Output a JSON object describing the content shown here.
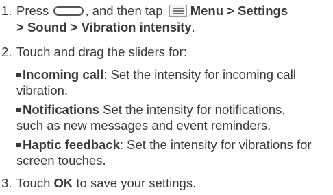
{
  "steps": [
    {
      "number": "1.",
      "parts": {
        "press": "Press",
        "then_tap": ", and then tap",
        "menu": "Menu",
        "sep1": " > ",
        "settings": "Settings",
        "sep2": "> ",
        "sound": "Sound",
        "sep3": " > ",
        "vibration_intensity": "Vibration intensity",
        "end": "."
      }
    },
    {
      "number": "2.",
      "text": "Touch and drag the sliders for:",
      "bullets": [
        {
          "term": "Incoming call",
          "sep": ":",
          "desc_line1": " Set the intensity for incoming call",
          "desc_line2": "vibration."
        },
        {
          "term": "Notifications",
          "sep": "",
          "desc_line1": " Set the intensity for notifications,",
          "desc_line2": "such as new messages and event reminders."
        },
        {
          "term": "Haptic feedback",
          "sep": ":",
          "desc_line1": " Set the intensity for vibrations for",
          "desc_line2": "screen touches."
        }
      ]
    },
    {
      "number": "3.",
      "parts": {
        "touch": "Touch ",
        "ok": "OK",
        "rest": " to save your settings."
      }
    }
  ],
  "icons": {
    "home_button": "home-button-icon",
    "menu": "menu-icon"
  }
}
